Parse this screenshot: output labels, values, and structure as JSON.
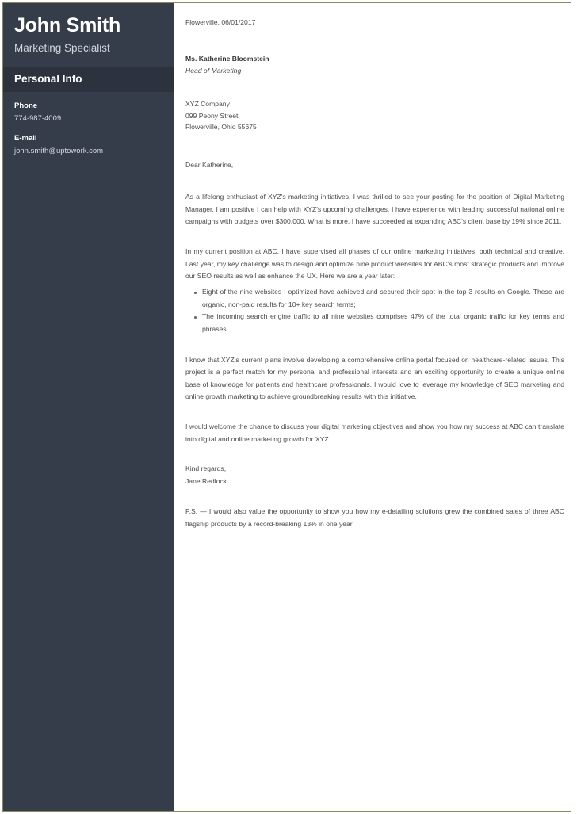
{
  "document": {
    "type": "cover-letter",
    "accent_border_color": "#8b8a5d",
    "sidebar_color": "#353d4b",
    "sidebar_band_color": "#2c323e",
    "body_text_color": "#4a4a4a"
  },
  "sidebar": {
    "full_name": "John Smith",
    "job_title": "Marketing Specialist",
    "section_title": "Personal Info",
    "contacts": [
      {
        "label": "Phone",
        "value": "774-987-4009"
      },
      {
        "label": "E-mail",
        "value": "john.smith@uptowork.com"
      }
    ]
  },
  "letter": {
    "date_line": "Flowerville, 06/01/2017",
    "recipient": {
      "name": "Ms. Katherine Bloomstein",
      "role": "Head of Marketing"
    },
    "address": [
      "XYZ Company",
      "099 Peony Street",
      "Flowerville, Ohio 55675"
    ],
    "salutation": "Dear Katherine,",
    "paragraphs": [
      "As a lifelong enthusiast of XYZ's marketing initiatives, I was thrilled to see your posting for the position of Digital Marketing Manager. I am positive I can help with XYZ's upcoming challenges. I have experience with leading successful national online campaigns with budgets over $300,000. What is more, I have succeeded at expanding ABC's client base by 19% since 2011.",
      "In my current position at ABC, I have supervised all phases of our online marketing initiatives, both technical and creative. Last year, my key challenge was to design and optimize nine product websites for ABC's most strategic products and improve our SEO results as well as enhance the UX. Here we are a year later:"
    ],
    "bullets": [
      "Eight of the nine websites I optimized have achieved and secured their spot in the top 3 results on Google. These are organic, non-paid results for 10+ key search terms;",
      "The incoming search engine traffic to all nine websites comprises 47% of the total organic traffic for key terms and phrases."
    ],
    "paragraphs_after": [
      "I know that XYZ's current plans involve developing a comprehensive online portal focused on healthcare-related issues. This project is a perfect match for my personal and professional interests and an exciting opportunity to create a unique online base of knowledge for patients and healthcare professionals. I would love to leverage my knowledge of SEO marketing and online growth marketing to achieve groundbreaking results with this initiative.",
      "I would welcome the chance to discuss your digital marketing objectives and show you how my success at ABC can translate into digital and online marketing growth for XYZ."
    ],
    "closing": "Kind regards,",
    "signature": "Jane Redlock",
    "postscript": "P.S. — I would also value the opportunity to show you how my e-detailing solutions grew the combined sales of three ABC flagship products by a record-breaking 13% in one year."
  }
}
